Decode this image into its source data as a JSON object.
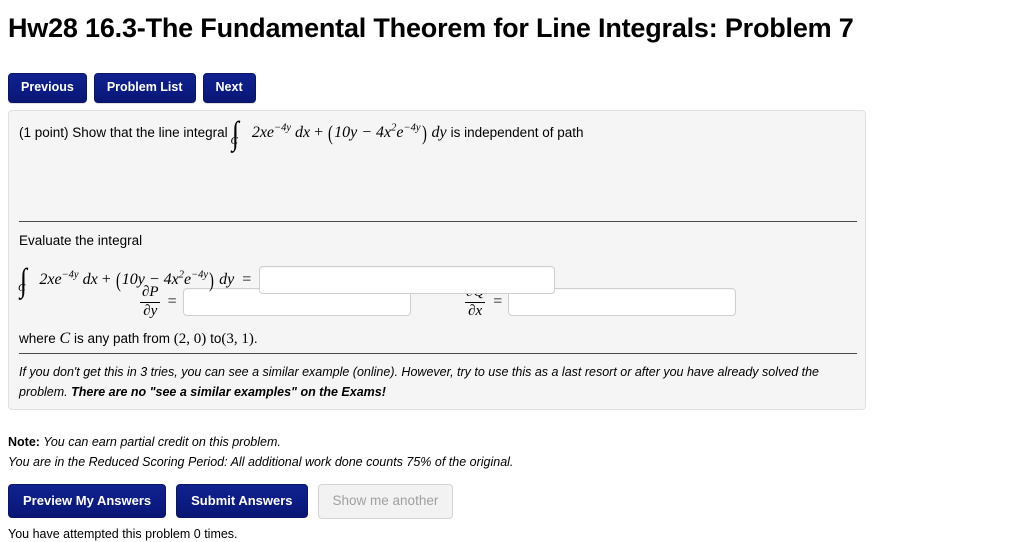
{
  "page_title": "Hw28 16.3-The Fundamental Theorem for Line Integrals: Problem 7",
  "nav": {
    "previous": "Previous",
    "problem_list": "Problem List",
    "next": "Next"
  },
  "problem": {
    "points": "(1 point)",
    "statement_prefix": "Show that the line integral",
    "integral": {
      "sign": "∫",
      "subscript": "C",
      "first_term_coeff": "2xe",
      "first_term_exp": "−4y",
      "dx": "dx",
      "plus": "+",
      "paren_open": "(",
      "second_term_a": "10y − 4x",
      "second_term_a_exp": "2",
      "second_term_b": "e",
      "second_term_b_exp": "−4y",
      "paren_close": ")",
      "dy": "dy"
    },
    "statement_suffix": "is independent of path",
    "partial_p": {
      "numerator": "∂P",
      "denominator": "∂y",
      "equals": "=",
      "value": ""
    },
    "partial_q": {
      "numerator": "∂Q",
      "denominator": "∂x",
      "equals": "=",
      "value": ""
    },
    "evaluate_label": "Evaluate the integral",
    "answer_equals": "=",
    "answer_value": "",
    "where_prefix": "where",
    "where_curve": "C",
    "where_mid": "is any path from",
    "point_start": "(2, 0)",
    "where_to": "to",
    "point_end": "(3, 1)",
    "where_end": ".",
    "hint_line1": "If you don't get this in 3 tries, you can see a similar example (online). However, try to use this as a last resort or after you have already solved the problem. ",
    "hint_bold": "There are no \"see a similar examples\" on the Exams!"
  },
  "notes": {
    "label": "Note:",
    "line1": " You can earn partial credit on this problem.",
    "line2": "You are in the Reduced Scoring Period: All additional work done counts 75% of the original."
  },
  "actions": {
    "preview": "Preview My Answers",
    "submit": "Submit Answers",
    "show_another": "Show me another"
  },
  "attempts": "You have attempted this problem 0 times.",
  "colors": {
    "button_blue": "#0d1d86",
    "panel_background": "#f5f5f5",
    "panel_border": "#e0e0e0",
    "disabled_text": "#a0a0a0"
  }
}
